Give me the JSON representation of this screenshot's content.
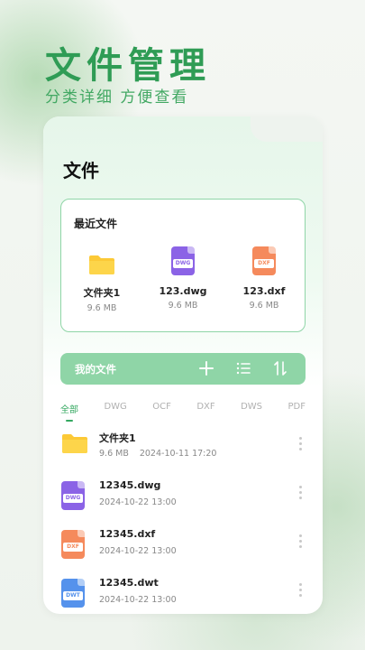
{
  "hero": {
    "title": "文件管理",
    "subtitle": "分类详细  方便查看"
  },
  "card": {
    "title": "文件",
    "recent": {
      "title": "最近文件",
      "items": [
        {
          "name": "文件夹1",
          "size": "9.6 MB",
          "icon": "folder-icon"
        },
        {
          "name": "123.dwg",
          "size": "9.6 MB",
          "icon": "dwg-file-icon",
          "badge": "DWG"
        },
        {
          "name": "123.dxf",
          "size": "9.6 MB",
          "icon": "dxf-file-icon",
          "badge": "DXF"
        }
      ]
    },
    "my_files": {
      "label": "我的文件",
      "actions": [
        "add-icon",
        "list-icon",
        "sort-icon"
      ]
    },
    "tabs": [
      "全部",
      "DWG",
      "OCF",
      "DXF",
      "DWS",
      "PDF"
    ],
    "active_tab": "全部",
    "files": [
      {
        "name": "文件夹1",
        "size": "9.6 MB",
        "date": "2024-10-11  17:20",
        "icon": "folder-icon"
      },
      {
        "name": "12345.dwg",
        "date": "2024-10-22  13:00",
        "icon": "dwg-file-icon",
        "badge": "DWG"
      },
      {
        "name": "12345.dxf",
        "date": "2024-10-22  13:00",
        "icon": "dxf-file-icon",
        "badge": "DXF"
      },
      {
        "name": "12345.dwt",
        "date": "2024-10-22  13:00",
        "icon": "dwt-file-icon",
        "badge": "DWT"
      }
    ]
  },
  "colors": {
    "accent_green": "#34a860",
    "bar_green": "#8fd5a7",
    "folder_yellow": "#fcc936",
    "dwg_purple": "#8b63e6",
    "dxf_orange": "#f58a5c",
    "dwt_blue": "#5592ec"
  }
}
